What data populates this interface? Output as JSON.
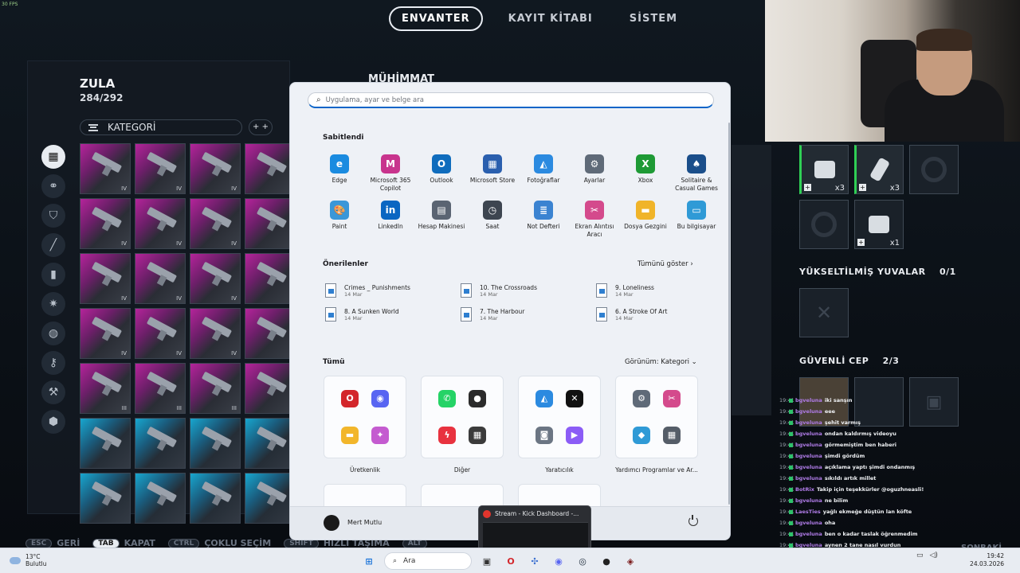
{
  "game": {
    "fps": "30 FPS",
    "tabs": [
      {
        "label": "ENVANTER",
        "active": true
      },
      {
        "label": "KAYIT KİTABI",
        "active": false
      },
      {
        "label": "SİSTEM",
        "active": false
      }
    ],
    "zula_title": "ZULA",
    "zula_count": "284/292",
    "category_label": "KATEGORİ",
    "sort_label": "+ +",
    "muhimmat": "MÜHİMMAT",
    "upgraded_slots_label": "YÜKSELTİLMİŞ YUVALAR",
    "upgraded_slots_count": "0/1",
    "safe_pocket_label": "GÜVENLİ CEP",
    "safe_pocket_count": "2/3",
    "slot_qty": [
      "x3",
      "x3",
      "x1"
    ],
    "cell_tags": [
      "IV",
      "III"
    ],
    "hints": [
      {
        "key": "ESC",
        "label": "GERİ"
      },
      {
        "key": "TAB",
        "label": "KAPAT"
      },
      {
        "key": "CTRL",
        "label": "ÇOKLU SEÇİM"
      },
      {
        "key": "SHIFT",
        "label": "HIZLI TAŞIMA"
      },
      {
        "key": "ALT",
        "label": ""
      },
      {
        "key": "",
        "label": "SONRAKİ"
      }
    ]
  },
  "chat": [
    {
      "time": "19:41",
      "user": "bgveluna",
      "msg": "iki sanşın"
    },
    {
      "time": "19:41",
      "user": "bgveluna",
      "msg": "eee"
    },
    {
      "time": "19:41",
      "user": "bgveluna",
      "msg": "şehit varmış"
    },
    {
      "time": "19:41",
      "user": "bgveluna",
      "msg": "ondan kaldırmış videoyu"
    },
    {
      "time": "19:41",
      "user": "bgveluna",
      "msg": "görmemiştim ben haberi"
    },
    {
      "time": "19:41",
      "user": "bgveluna",
      "msg": "şimdi gördüm"
    },
    {
      "time": "19:41",
      "user": "bgveluna",
      "msg": "açıklama yaptı şimdi ondanmış"
    },
    {
      "time": "19:41",
      "user": "bgveluna",
      "msg": "sıkıldı artık millet"
    },
    {
      "time": "19:41",
      "user": "BotRix",
      "msg": "Takip için teşekkürler @oguzhneasli!"
    },
    {
      "time": "19:41",
      "user": "bgveluna",
      "msg": "ne bilim"
    },
    {
      "time": "19:41",
      "user": "LaesTies",
      "msg": "yağlı ekmeğe düştün lan köfte"
    },
    {
      "time": "19:41",
      "user": "bgveluna",
      "msg": "oha"
    },
    {
      "time": "19:41",
      "user": "bgveluna",
      "msg": "ben o kadar taslak öğrenmedim"
    },
    {
      "time": "19:41",
      "user": "bgveluna",
      "msg": "aynen 2 tane nasıl vurdun"
    },
    {
      "time": "19:41",
      "user": "",
      "msg": "Ayhan yokken nekadar güzel oyun"
    },
    {
      "time": "19:41",
      "user": "",
      "msg": "az kaldı ratlım sabret"
    }
  ],
  "start_menu": {
    "search_placeholder": "Uygulama, ayar ve belge ara",
    "pinned_title": "Sabitlendi",
    "pinned": [
      {
        "name": "Edge",
        "icon": "edge-icon",
        "color": "#1a8be0",
        "glyph": "e"
      },
      {
        "name": "Microsoft 365 Copilot",
        "icon": "m365-icon",
        "color": "#c8348d",
        "glyph": "M"
      },
      {
        "name": "Outlook",
        "icon": "outlook-icon",
        "color": "#0f6cbd",
        "glyph": "O"
      },
      {
        "name": "Microsoft Store",
        "icon": "store-icon",
        "color": "#2a5fae",
        "glyph": "▦"
      },
      {
        "name": "Fotoğraflar",
        "icon": "photos-icon",
        "color": "#2b8ae0",
        "glyph": "◭"
      },
      {
        "name": "Ayarlar",
        "icon": "settings-icon",
        "color": "#5f6a78",
        "glyph": "⚙"
      },
      {
        "name": "Xbox",
        "icon": "xbox-icon",
        "color": "#1e9a35",
        "glyph": "X"
      },
      {
        "name": "Solitaire & Casual Games",
        "icon": "solitaire-icon",
        "color": "#1a4e8a",
        "glyph": "♠"
      },
      {
        "name": "Paint",
        "icon": "paint-icon",
        "color": "#3a97d8",
        "glyph": "🎨"
      },
      {
        "name": "LinkedIn",
        "icon": "linkedin-icon",
        "color": "#0a66c2",
        "glyph": "in"
      },
      {
        "name": "Hesap Makinesi",
        "icon": "calculator-icon",
        "color": "#5a6472",
        "glyph": "▤"
      },
      {
        "name": "Saat",
        "icon": "clock-icon",
        "color": "#3d4550",
        "glyph": "◷"
      },
      {
        "name": "Not Defteri",
        "icon": "notepad-icon",
        "color": "#3b83d1",
        "glyph": "≣"
      },
      {
        "name": "Ekran Alıntısı Aracı",
        "icon": "snipping-icon",
        "color": "#d44a8c",
        "glyph": "✂"
      },
      {
        "name": "Dosya Gezgini",
        "icon": "folder-icon",
        "color": "#f0b429",
        "glyph": "▬"
      },
      {
        "name": "Bu bilgisayar",
        "icon": "computer-icon",
        "color": "#2f9ad6",
        "glyph": "▭"
      }
    ],
    "recommended_title": "Önerilenler",
    "show_all": "Tümünü göster",
    "recommended": [
      {
        "title": "Crimes _ Punishments",
        "date": "14 Mar"
      },
      {
        "title": "10. The Crossroads",
        "date": "14 Mar"
      },
      {
        "title": "9. Loneliness",
        "date": "14 Mar"
      },
      {
        "title": "8. A Sunken World",
        "date": "14 Mar"
      },
      {
        "title": "7. The Harbour",
        "date": "14 Mar"
      },
      {
        "title": "6. A Stroke Of Art",
        "date": "14 Mar"
      }
    ],
    "all_title": "Tümü",
    "view_label": "Görünüm: Kategori",
    "groups": [
      {
        "name": "Üretkenlik",
        "icons": [
          {
            "c": "#d3262b",
            "g": "O"
          },
          {
            "c": "#5865f2",
            "g": "◉"
          },
          {
            "c": "#f2b62b",
            "g": "▬"
          },
          {
            "c": "#c45bd0",
            "g": "✦"
          }
        ]
      },
      {
        "name": "Diğer",
        "icons": [
          {
            "c": "#25d366",
            "g": "✆"
          },
          {
            "c": "#2b2b2b",
            "g": "●"
          },
          {
            "c": "#e8323f",
            "g": "ϟ"
          },
          {
            "c": "#3b3b3b",
            "g": "▦"
          }
        ]
      },
      {
        "name": "Yaratıcılık",
        "icons": [
          {
            "c": "#2b8ae0",
            "g": "◭"
          },
          {
            "c": "#111111",
            "g": "✕"
          },
          {
            "c": "#6b7583",
            "g": "◙"
          },
          {
            "c": "#8b5cf6",
            "g": "▶"
          }
        ]
      },
      {
        "name": "Yardımcı Programlar ve Ar...",
        "icons": [
          {
            "c": "#5f6a78",
            "g": "⚙"
          },
          {
            "c": "#d44a8c",
            "g": "✂"
          },
          {
            "c": "#2f9ad6",
            "g": "◆"
          },
          {
            "c": "#555d68",
            "g": "▦"
          }
        ]
      }
    ],
    "user_name": "Mert Mutlu"
  },
  "kick_popup": {
    "title": "Stream - Kick Dashboard -..."
  },
  "taskbar": {
    "weather_temp": "13°C",
    "weather_desc": "Bulutlu",
    "search_label": "Ara",
    "time": "19:42",
    "date": "24.03.2026"
  }
}
